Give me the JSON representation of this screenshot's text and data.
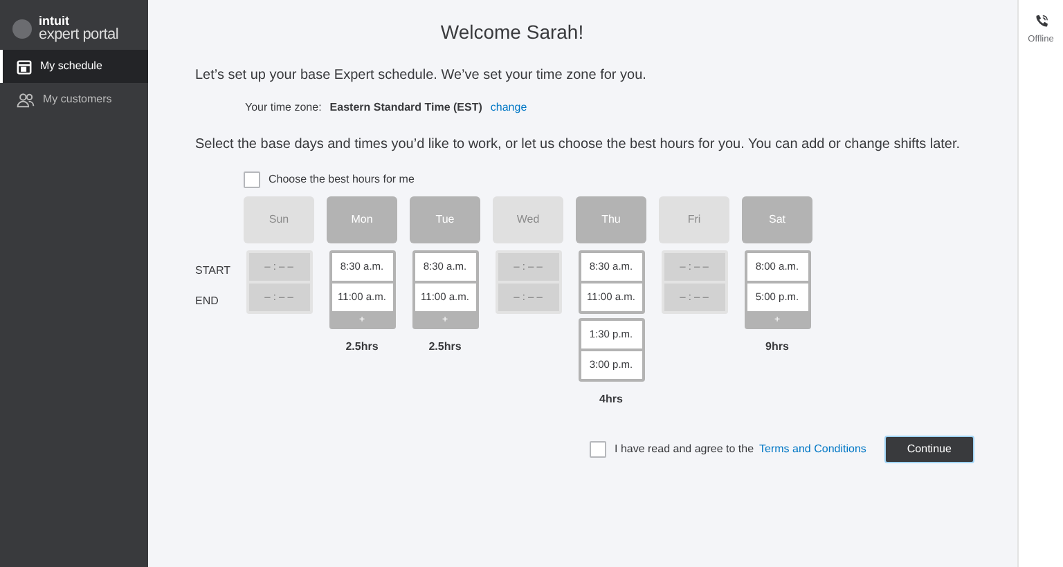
{
  "sidebar": {
    "logo_brand": "intuit",
    "logo_product": "expert portal",
    "items": [
      {
        "label": "My schedule",
        "selected": true
      },
      {
        "label": "My customers",
        "selected": false
      }
    ]
  },
  "status": {
    "label": "Offline"
  },
  "title": "Welcome Sarah!",
  "intro": "Let’s set up your base Expert schedule. We’ve set your time zone for you.",
  "timezone": {
    "label": "Your time zone:",
    "value": "Eastern Standard Time (EST)",
    "link": "change"
  },
  "instructions": "Select the base days and times you’d like to work, or let us choose the best hours for you. You can add or change shifts later.",
  "best_hours": {
    "label": "Choose the best hours for me",
    "checked": false
  },
  "row_labels": [
    "START",
    "END"
  ],
  "days": [
    {
      "label": "Sun",
      "selected": false,
      "shifts": [
        {
          "start": "– : – –",
          "end": "– : – –"
        }
      ],
      "add": false
    },
    {
      "label": "Mon",
      "selected": true,
      "shifts": [
        {
          "start": "8:30 a.m.",
          "end": "11:00 a.m."
        }
      ],
      "add": true,
      "add_label": "+",
      "total": "2.5hrs"
    },
    {
      "label": "Tue",
      "selected": true,
      "shifts": [
        {
          "start": "8:30 a.m.",
          "end": "11:00 a.m."
        }
      ],
      "add": true,
      "add_label": "+",
      "total": "2.5hrs"
    },
    {
      "label": "Wed",
      "selected": false,
      "shifts": [
        {
          "start": "– : – –",
          "end": "– : – –"
        }
      ],
      "add": false
    },
    {
      "label": "Thu",
      "selected": true,
      "shifts": [
        {
          "start": "8:30 a.m.",
          "end": "11:00 a.m."
        },
        {
          "start": "1:30 p.m.",
          "end": "3:00 p.m."
        }
      ],
      "add": false,
      "total": "4hrs"
    },
    {
      "label": "Fri",
      "selected": false,
      "shifts": [
        {
          "start": "– : – –",
          "end": "– : – –"
        }
      ],
      "add": false
    },
    {
      "label": "Sat",
      "selected": true,
      "shifts": [
        {
          "start": "8:00 a.m.",
          "end": "5:00 p.m."
        }
      ],
      "add": true,
      "add_label": "+",
      "total": "9hrs"
    }
  ],
  "terms": {
    "text": "I have read and agree to the",
    "link": "Terms and Conditions",
    "checked": false
  },
  "continue_button": "Continue"
}
